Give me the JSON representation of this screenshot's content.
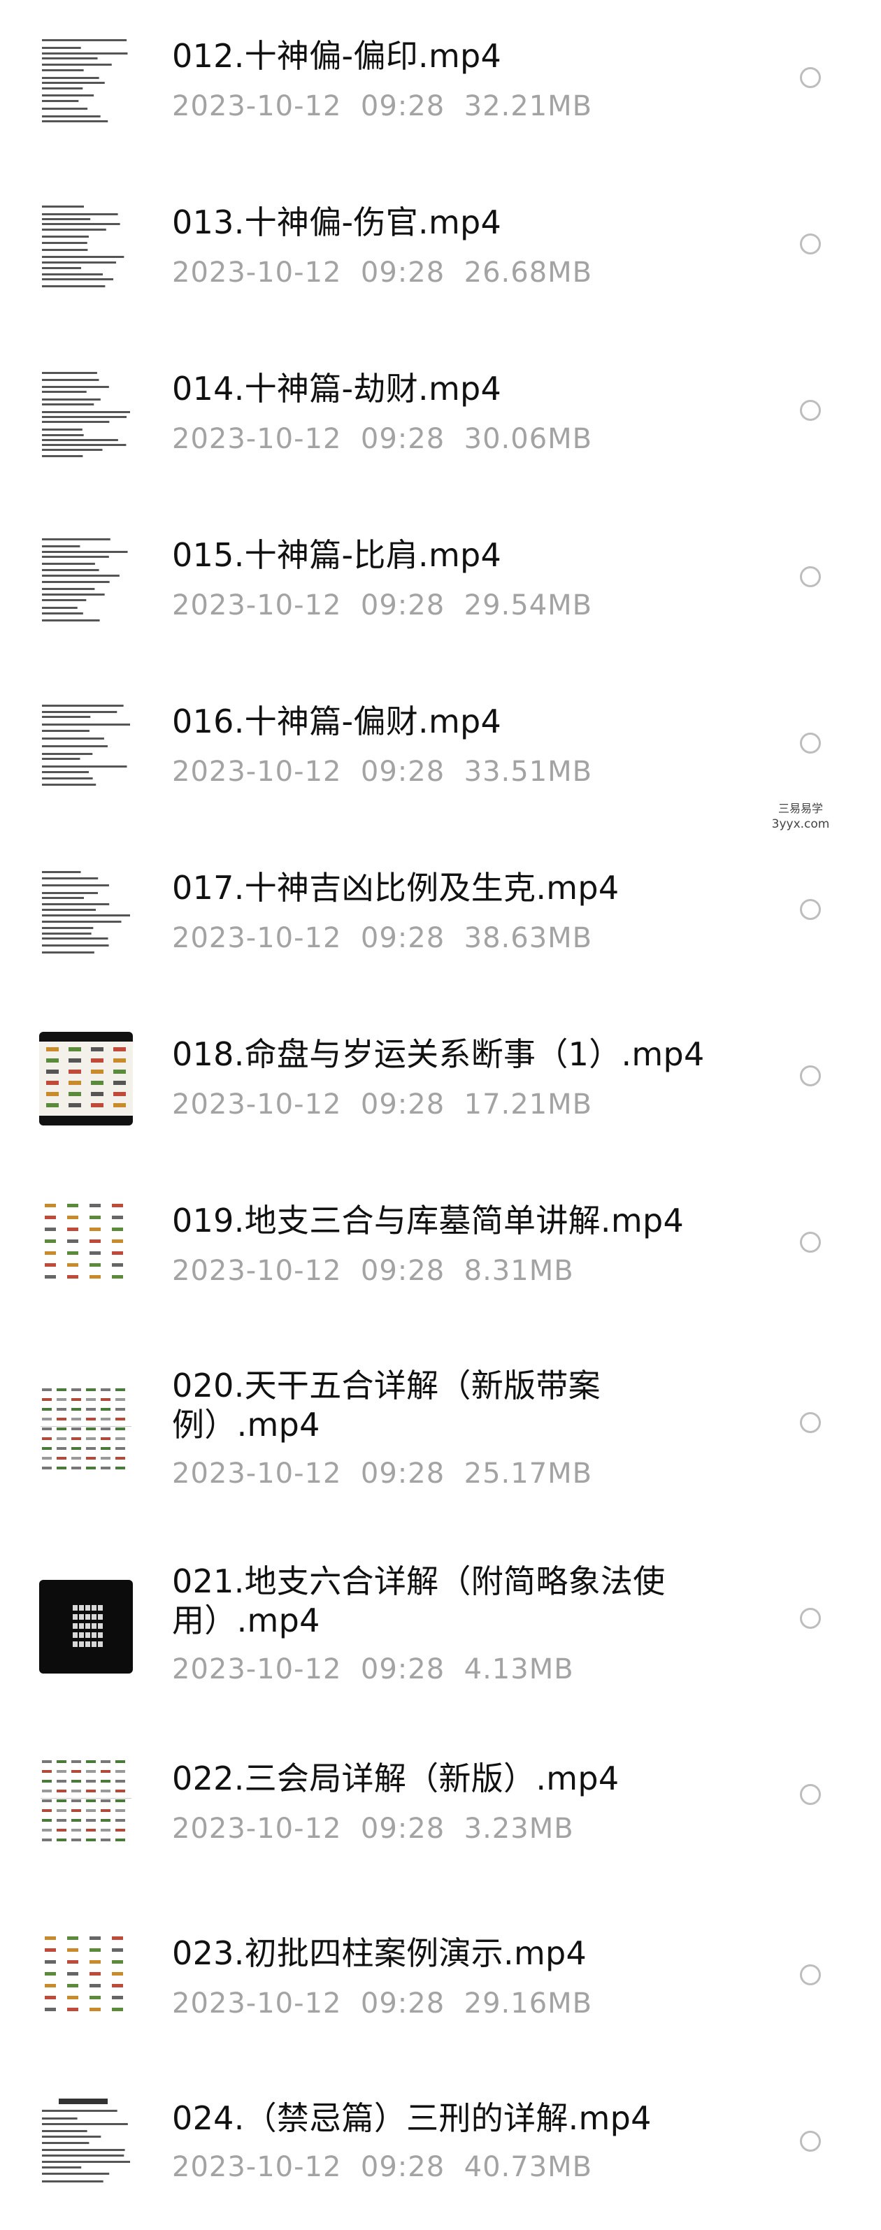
{
  "files": [
    {
      "name": "012.十神偏-偏印.mp4",
      "date": "2023-10-12",
      "time": "09:28",
      "size": "32.21MB",
      "thumb": "doc-text-icon"
    },
    {
      "name": "013.十神偏-伤官.mp4",
      "date": "2023-10-12",
      "time": "09:28",
      "size": "26.68MB",
      "thumb": "doc-text-icon"
    },
    {
      "name": "014.十神篇-劫财.mp4",
      "date": "2023-10-12",
      "time": "09:28",
      "size": "30.06MB",
      "thumb": "doc-text-icon"
    },
    {
      "name": "015.十神篇-比肩.mp4",
      "date": "2023-10-12",
      "time": "09:28",
      "size": "29.54MB",
      "thumb": "doc-text-icon"
    },
    {
      "name": "016.十神篇-偏财.mp4",
      "date": "2023-10-12",
      "time": "09:28",
      "size": "33.51MB",
      "thumb": "doc-text-icon"
    },
    {
      "name": "017.十神吉凶比例及生克.mp4",
      "date": "2023-10-12",
      "time": "09:28",
      "size": "38.63MB",
      "thumb": "doc-text-icon"
    },
    {
      "name": "018.命盘与岁运关系断事（1）.mp4",
      "date": "2023-10-12",
      "time": "09:28",
      "size": "17.21MB",
      "thumb": "chart-dark-icon"
    },
    {
      "name": "019.地支三合与库墓简单讲解.mp4",
      "date": "2023-10-12",
      "time": "09:28",
      "size": "8.31MB",
      "thumb": "chart-light-icon"
    },
    {
      "name": "020.天干五合详解（新版带案例）.mp4",
      "date": "2023-10-12",
      "time": "09:28",
      "size": "25.17MB",
      "thumb": "table-icon"
    },
    {
      "name": "021.地支六合详解（附简略象法使用）.mp4",
      "date": "2023-10-12",
      "time": "09:28",
      "size": "4.13MB",
      "thumb": "black-screen-icon"
    },
    {
      "name": "022.三会局详解（新版）.mp4",
      "date": "2023-10-12",
      "time": "09:28",
      "size": "3.23MB",
      "thumb": "table-icon"
    },
    {
      "name": "023.初批四柱案例演示.mp4",
      "date": "2023-10-12",
      "time": "09:28",
      "size": "29.16MB",
      "thumb": "chart-light-icon"
    },
    {
      "name": "024.（禁忌篇）三刑的详解.mp4",
      "date": "2023-10-12",
      "time": "09:28",
      "size": "40.73MB",
      "thumb": "doc-titled-icon"
    }
  ],
  "watermark": {
    "line1": "三易易学",
    "line2": "3yyx.com"
  },
  "colors": {
    "text": "#111111",
    "meta": "#a3a3a3",
    "radio": "#bdbdbd",
    "background": "#ffffff"
  }
}
